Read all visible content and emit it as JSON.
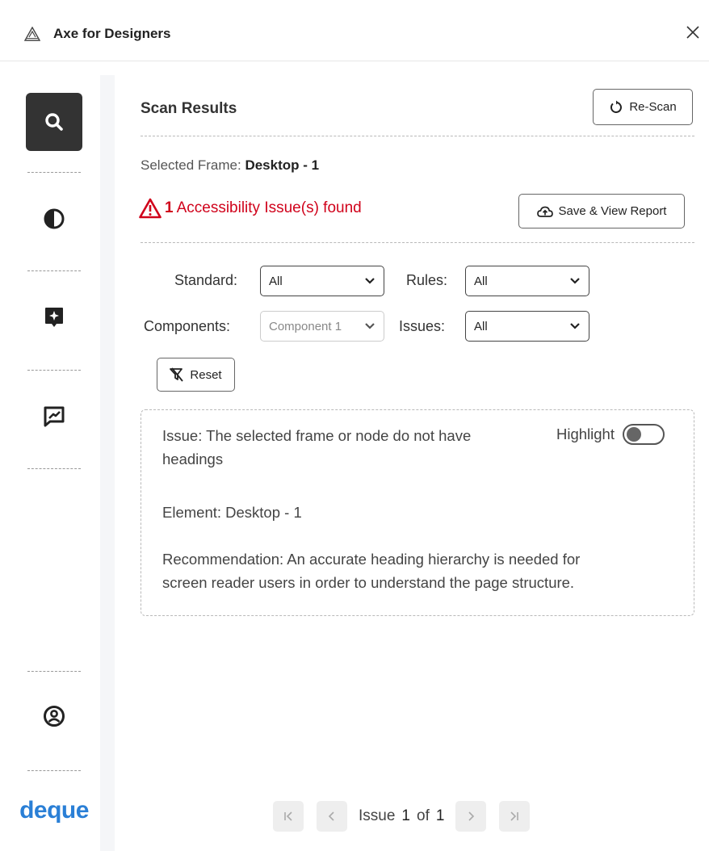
{
  "window": {
    "title": "Axe for Designers",
    "logo_icon": "axe-logo-icon",
    "close_icon": "close-icon"
  },
  "sidebar": {
    "items": [
      {
        "name": "scan",
        "icon": "search-icon",
        "active": true
      },
      {
        "name": "color-contrast",
        "icon": "contrast-icon",
        "active": false
      },
      {
        "name": "annotations",
        "icon": "sparkle-message-icon",
        "active": false
      },
      {
        "name": "feedback",
        "icon": "feedback-chart-icon",
        "active": false
      },
      {
        "name": "account",
        "icon": "user-circle-icon",
        "active": false
      }
    ],
    "brand": "deque"
  },
  "header": {
    "title": "Scan Results",
    "rescan_label": "Re-Scan"
  },
  "selection": {
    "label": "Selected Frame: ",
    "value": "Desktop - 1"
  },
  "summary": {
    "count": "1",
    "text": "Accessibility Issue(s) found",
    "save_label": "Save & View Report"
  },
  "filters": {
    "standard": {
      "label": "Standard:",
      "value": "All"
    },
    "rules": {
      "label": "Rules:",
      "value": "All"
    },
    "components": {
      "label": "Components:",
      "value": "Component 1"
    },
    "issues": {
      "label": "Issues:",
      "value": "All"
    },
    "reset_label": "Reset"
  },
  "issue_card": {
    "issue_line1": "Issue: The selected frame or node do not have",
    "issue_line2": "headings",
    "highlight_label": "Highlight",
    "highlight_on": false,
    "element": "Element: Desktop - 1",
    "recommendation_line1": "Recommendation: An accurate heading hierarchy is needed for",
    "recommendation_line2": "screen reader users in order to understand the page structure."
  },
  "pagination": {
    "label": "Issue",
    "current": "1",
    "of_label": "of",
    "total": "1"
  },
  "colors": {
    "error": "#d0021b",
    "brand": "#2a7fd6",
    "active": "#333333"
  }
}
